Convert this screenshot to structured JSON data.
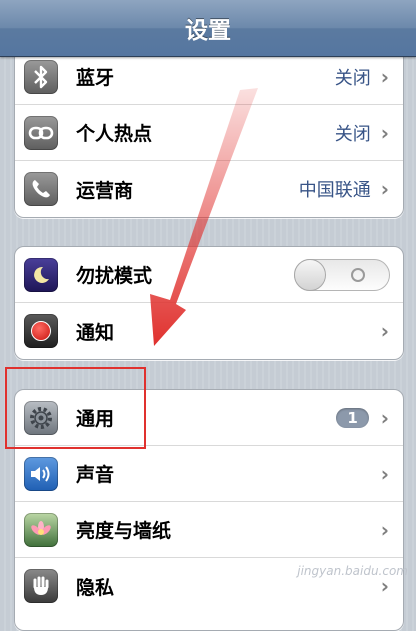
{
  "navbar": {
    "title": "设置"
  },
  "groups": [
    {
      "rows": [
        {
          "label": "蓝牙",
          "value": "关闭",
          "icon": "bluetooth-icon"
        },
        {
          "label": "个人热点",
          "value": "关闭",
          "icon": "hotspot-icon"
        },
        {
          "label": "运营商",
          "value": "中国联通",
          "icon": "phone-icon"
        }
      ]
    },
    {
      "rows": [
        {
          "label": "勿扰模式",
          "toggle": "off",
          "icon": "moon-icon"
        },
        {
          "label": "通知",
          "icon": "notification-icon"
        }
      ]
    },
    {
      "rows": [
        {
          "label": "通用",
          "badge": "1",
          "icon": "gear-icon"
        },
        {
          "label": "声音",
          "icon": "speaker-icon"
        },
        {
          "label": "亮度与墙纸",
          "icon": "flower-icon"
        },
        {
          "label": "隐私",
          "icon": "hand-icon"
        }
      ]
    }
  ],
  "watermark": "jingyan.baidu.com",
  "colors": {
    "annotation": "#e0312e",
    "value_text": "#385487",
    "nav": "#6c89ab"
  }
}
